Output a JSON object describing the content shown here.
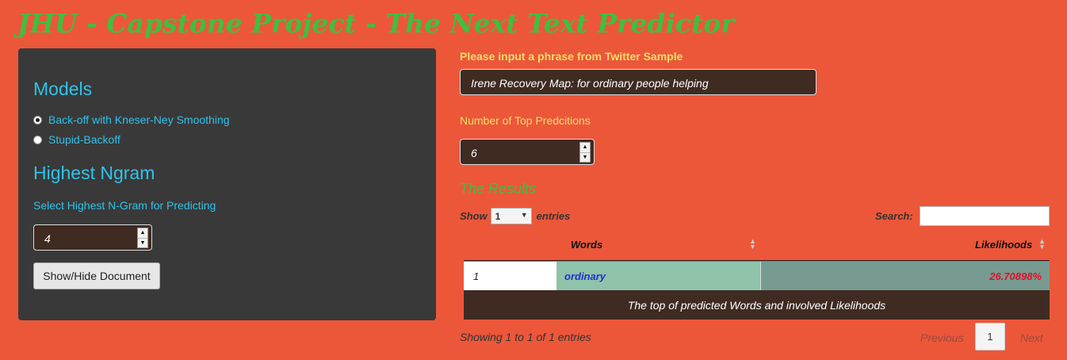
{
  "app": {
    "title": "JHU - Capstone Project - The Next Text Predictor"
  },
  "sidebar": {
    "models_heading": "Models",
    "models": [
      {
        "label": "Back-off with Kneser-Ney Smoothing",
        "checked": true
      },
      {
        "label": "Stupid-Backoff",
        "checked": false
      }
    ],
    "ngram_heading": "Highest Ngram",
    "ngram_label": "Select Highest N-Gram for Predicting",
    "ngram_value": "4",
    "toggle_button": "Show/Hide Document"
  },
  "main": {
    "phrase_label": "Please input a phrase from Twitter Sample",
    "phrase_value": "Irene Recovery Map: for ordinary people helping",
    "topn_label": "Number of Top Predcitions",
    "topn_value": "6",
    "results_heading": "The Results",
    "table": {
      "show_label": "Show",
      "entries_value": "1",
      "entries_label": "entries",
      "search_label": "Search:",
      "columns": [
        "Words",
        "Likelihoods"
      ],
      "rows": [
        {
          "index": "1",
          "word": "ordinary",
          "likelihood": "26.70898%"
        }
      ],
      "caption": "The top of predicted Words and involved Likelihoods",
      "info": "Showing 1 to 1 of 1 entries",
      "pagination": {
        "previous": "Previous",
        "page": "1",
        "next": "Next"
      }
    }
  }
}
